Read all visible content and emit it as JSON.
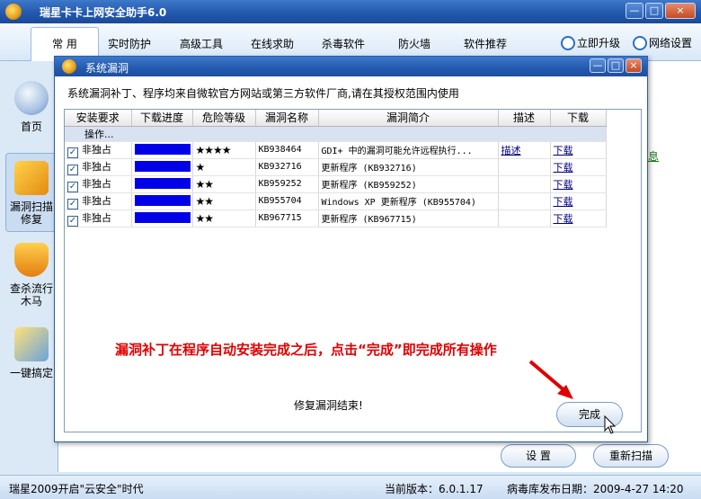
{
  "app": {
    "title": "瑞星卡卡上网安全助手6.0"
  },
  "window_controls": {
    "minimize": "—",
    "maximize": "□",
    "close": "×"
  },
  "menu": {
    "tabs": [
      "常 用",
      "实时防护",
      "高级工具",
      "在线求助",
      "杀毒软件",
      "防火墙",
      "软件推荐"
    ],
    "upgrade": "立即升级",
    "settings": "网络设置"
  },
  "sidebar": {
    "items": [
      {
        "label": "首页"
      },
      {
        "label": "漏洞扫描修复"
      },
      {
        "label": "查杀流行木马"
      },
      {
        "label": "一键搞定"
      }
    ]
  },
  "background": {
    "info_link": "息",
    "settings_button": "设 置",
    "rescan_button": "重新扫描"
  },
  "status": {
    "left": "瑞星2009开启\"云安全\"时代",
    "version": "当前版本：6.0.1.17",
    "virus_db": "病毒库发布日期：2009-4-27 14:20"
  },
  "dialog": {
    "title": "系统漏洞",
    "description": "系统漏洞补丁、程序均来自微软官方网站或第三方软件厂商,请在其授权范围内使用",
    "columns": [
      "安装要求",
      "下载进度",
      "危险等级",
      "漏洞名称",
      "漏洞简介",
      "描述",
      "下载"
    ],
    "group_label": "操作...",
    "rows": [
      {
        "req": "非独占",
        "stars": "★★★★",
        "name": "KB938464",
        "intro": "GDI+ 中的漏洞可能允许远程执行...",
        "desc": "描述",
        "download": "下载",
        "progress": 1.0
      },
      {
        "req": "非独占",
        "stars": "★",
        "name": "KB932716",
        "intro": "更新程序 (KB932716)",
        "desc": "",
        "download": "下载",
        "progress": 1.0
      },
      {
        "req": "非独占",
        "stars": "★★",
        "name": "KB959252",
        "intro": "更新程序 (KB959252)",
        "desc": "",
        "download": "下载",
        "progress": 1.0
      },
      {
        "req": "非独占",
        "stars": "★★",
        "name": "KB955704",
        "intro": "Windows XP 更新程序 (KB955704)",
        "desc": "",
        "download": "下载",
        "progress": 1.0
      },
      {
        "req": "非独占",
        "stars": "★★",
        "name": "KB967715",
        "intro": "更新程序 (KB967715)",
        "desc": "",
        "download": "下载",
        "progress": 1.0
      }
    ],
    "annotation": "漏洞补丁在程序自动安装完成之后，点击“完成”即完成所有操作",
    "finish_message": "修复漏洞结束!",
    "finish_button": "完成"
  }
}
